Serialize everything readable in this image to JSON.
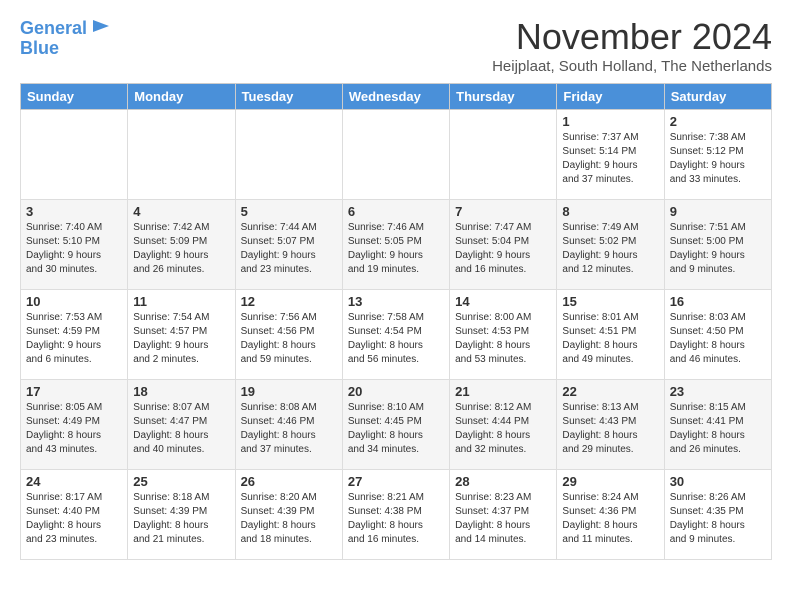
{
  "logo": {
    "line1": "General",
    "line2": "Blue"
  },
  "title": "November 2024",
  "location": "Heijplaat, South Holland, The Netherlands",
  "weekdays": [
    "Sunday",
    "Monday",
    "Tuesday",
    "Wednesday",
    "Thursday",
    "Friday",
    "Saturday"
  ],
  "weeks": [
    [
      {
        "day": "",
        "info": ""
      },
      {
        "day": "",
        "info": ""
      },
      {
        "day": "",
        "info": ""
      },
      {
        "day": "",
        "info": ""
      },
      {
        "day": "",
        "info": ""
      },
      {
        "day": "1",
        "info": "Sunrise: 7:37 AM\nSunset: 5:14 PM\nDaylight: 9 hours\nand 37 minutes."
      },
      {
        "day": "2",
        "info": "Sunrise: 7:38 AM\nSunset: 5:12 PM\nDaylight: 9 hours\nand 33 minutes."
      }
    ],
    [
      {
        "day": "3",
        "info": "Sunrise: 7:40 AM\nSunset: 5:10 PM\nDaylight: 9 hours\nand 30 minutes."
      },
      {
        "day": "4",
        "info": "Sunrise: 7:42 AM\nSunset: 5:09 PM\nDaylight: 9 hours\nand 26 minutes."
      },
      {
        "day": "5",
        "info": "Sunrise: 7:44 AM\nSunset: 5:07 PM\nDaylight: 9 hours\nand 23 minutes."
      },
      {
        "day": "6",
        "info": "Sunrise: 7:46 AM\nSunset: 5:05 PM\nDaylight: 9 hours\nand 19 minutes."
      },
      {
        "day": "7",
        "info": "Sunrise: 7:47 AM\nSunset: 5:04 PM\nDaylight: 9 hours\nand 16 minutes."
      },
      {
        "day": "8",
        "info": "Sunrise: 7:49 AM\nSunset: 5:02 PM\nDaylight: 9 hours\nand 12 minutes."
      },
      {
        "day": "9",
        "info": "Sunrise: 7:51 AM\nSunset: 5:00 PM\nDaylight: 9 hours\nand 9 minutes."
      }
    ],
    [
      {
        "day": "10",
        "info": "Sunrise: 7:53 AM\nSunset: 4:59 PM\nDaylight: 9 hours\nand 6 minutes."
      },
      {
        "day": "11",
        "info": "Sunrise: 7:54 AM\nSunset: 4:57 PM\nDaylight: 9 hours\nand 2 minutes."
      },
      {
        "day": "12",
        "info": "Sunrise: 7:56 AM\nSunset: 4:56 PM\nDaylight: 8 hours\nand 59 minutes."
      },
      {
        "day": "13",
        "info": "Sunrise: 7:58 AM\nSunset: 4:54 PM\nDaylight: 8 hours\nand 56 minutes."
      },
      {
        "day": "14",
        "info": "Sunrise: 8:00 AM\nSunset: 4:53 PM\nDaylight: 8 hours\nand 53 minutes."
      },
      {
        "day": "15",
        "info": "Sunrise: 8:01 AM\nSunset: 4:51 PM\nDaylight: 8 hours\nand 49 minutes."
      },
      {
        "day": "16",
        "info": "Sunrise: 8:03 AM\nSunset: 4:50 PM\nDaylight: 8 hours\nand 46 minutes."
      }
    ],
    [
      {
        "day": "17",
        "info": "Sunrise: 8:05 AM\nSunset: 4:49 PM\nDaylight: 8 hours\nand 43 minutes."
      },
      {
        "day": "18",
        "info": "Sunrise: 8:07 AM\nSunset: 4:47 PM\nDaylight: 8 hours\nand 40 minutes."
      },
      {
        "day": "19",
        "info": "Sunrise: 8:08 AM\nSunset: 4:46 PM\nDaylight: 8 hours\nand 37 minutes."
      },
      {
        "day": "20",
        "info": "Sunrise: 8:10 AM\nSunset: 4:45 PM\nDaylight: 8 hours\nand 34 minutes."
      },
      {
        "day": "21",
        "info": "Sunrise: 8:12 AM\nSunset: 4:44 PM\nDaylight: 8 hours\nand 32 minutes."
      },
      {
        "day": "22",
        "info": "Sunrise: 8:13 AM\nSunset: 4:43 PM\nDaylight: 8 hours\nand 29 minutes."
      },
      {
        "day": "23",
        "info": "Sunrise: 8:15 AM\nSunset: 4:41 PM\nDaylight: 8 hours\nand 26 minutes."
      }
    ],
    [
      {
        "day": "24",
        "info": "Sunrise: 8:17 AM\nSunset: 4:40 PM\nDaylight: 8 hours\nand 23 minutes."
      },
      {
        "day": "25",
        "info": "Sunrise: 8:18 AM\nSunset: 4:39 PM\nDaylight: 8 hours\nand 21 minutes."
      },
      {
        "day": "26",
        "info": "Sunrise: 8:20 AM\nSunset: 4:39 PM\nDaylight: 8 hours\nand 18 minutes."
      },
      {
        "day": "27",
        "info": "Sunrise: 8:21 AM\nSunset: 4:38 PM\nDaylight: 8 hours\nand 16 minutes."
      },
      {
        "day": "28",
        "info": "Sunrise: 8:23 AM\nSunset: 4:37 PM\nDaylight: 8 hours\nand 14 minutes."
      },
      {
        "day": "29",
        "info": "Sunrise: 8:24 AM\nSunset: 4:36 PM\nDaylight: 8 hours\nand 11 minutes."
      },
      {
        "day": "30",
        "info": "Sunrise: 8:26 AM\nSunset: 4:35 PM\nDaylight: 8 hours\nand 9 minutes."
      }
    ]
  ]
}
